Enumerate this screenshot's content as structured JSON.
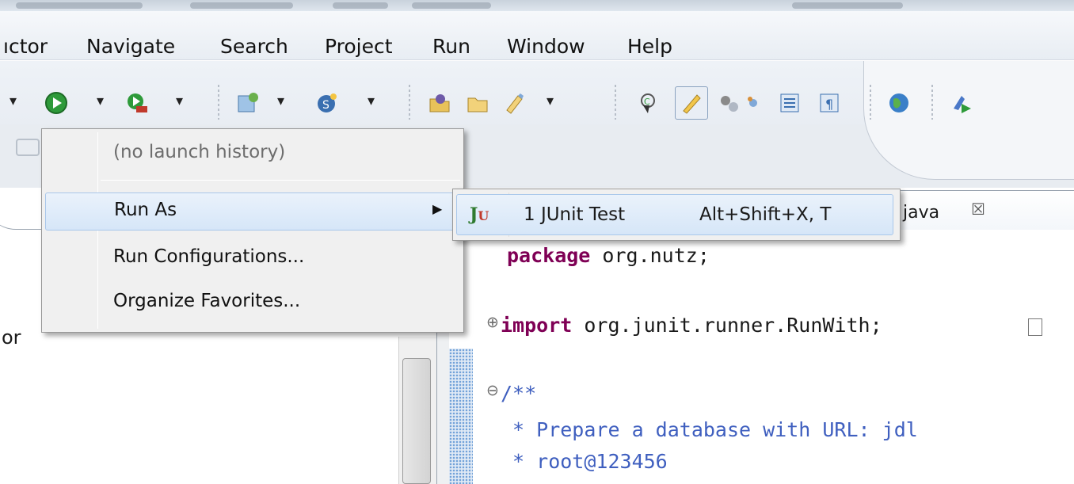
{
  "menubar": {
    "items": [
      {
        "label": "ıctor"
      },
      {
        "label": "Navigate"
      },
      {
        "label": "Search"
      },
      {
        "label": "Project"
      },
      {
        "label": "Run"
      },
      {
        "label": "Window"
      },
      {
        "label": "Help"
      }
    ]
  },
  "toolbar": {
    "icons": [
      "run-icon",
      "external-tools-icon",
      "new-class-icon",
      "new-server-icon",
      "open-type-icon",
      "open-folder-icon",
      "marker-icon",
      "toggle-breadcrumb-icon",
      "mark-occurrences-icon",
      "block-selection-icon",
      "show-whitespace-icon",
      "pilcrow-icon",
      "web-browser-icon",
      "deploy-icon"
    ],
    "dropdown_glyph": "▾"
  },
  "run_menu": {
    "items": [
      {
        "label": "(no launch history)",
        "enabled": false
      },
      {
        "label": "Run As",
        "has_submenu": true,
        "highlighted": true
      },
      {
        "label": "Run Configurations...",
        "enabled": true
      },
      {
        "label": "Organize Favorites...",
        "enabled": true
      }
    ],
    "submenu_arrow": "▶"
  },
  "run_as_submenu": {
    "item": {
      "icon_j": "J",
      "icon_u": "U",
      "label": "1 JUnit Test",
      "accelerator": "Alt+Shift+X, T"
    }
  },
  "editor": {
    "tab_label": "java",
    "tab_close_glyph": "☒",
    "fold_expand_glyph": "⊕",
    "fold_collapse_glyph": "⊖",
    "lines": [
      {
        "kw": "package",
        "rest": " org.nutz;"
      },
      {
        "kw": "import",
        "rest": " org.junit.runner.RunWith;"
      },
      {
        "comment": "/**"
      },
      {
        "comment": " * Prepare a database with URL: jdl"
      },
      {
        "comment": " * root@123456"
      }
    ]
  },
  "left_view": {
    "text": "or"
  }
}
